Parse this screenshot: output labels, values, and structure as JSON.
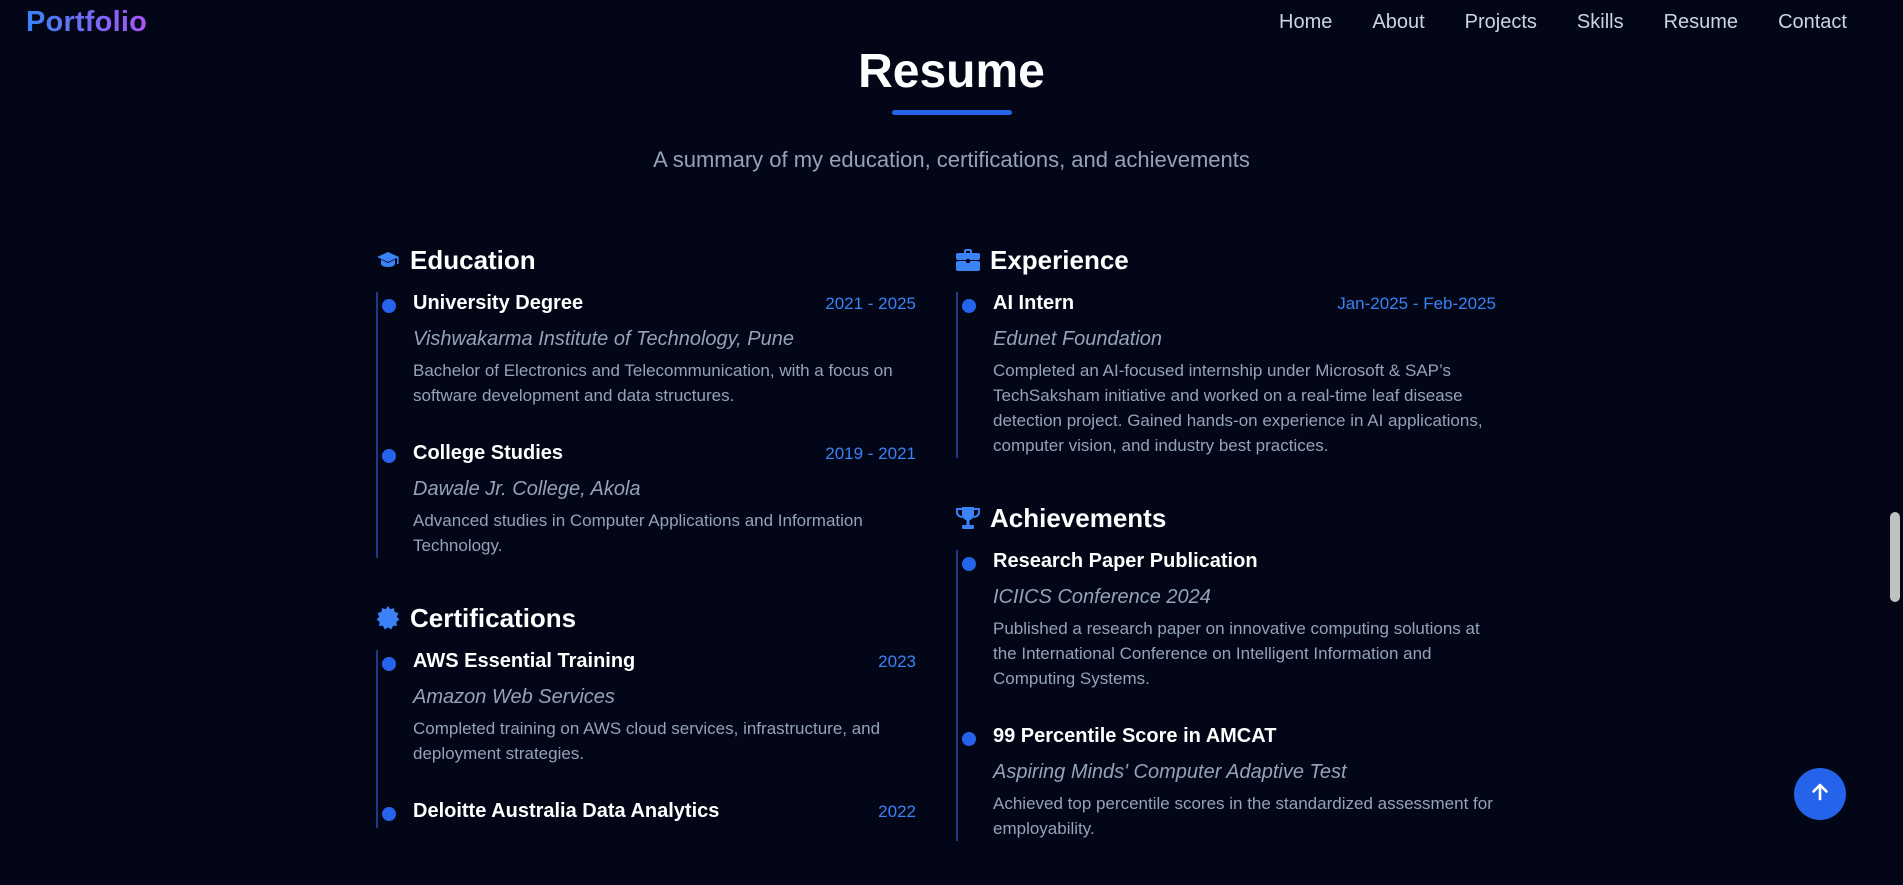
{
  "nav": {
    "logo": "Portfolio",
    "links": [
      "Home",
      "About",
      "Projects",
      "Skills",
      "Resume",
      "Contact"
    ]
  },
  "header": {
    "title": "Resume",
    "subtitle": "A summary of my education, certifications, and achievements"
  },
  "education": {
    "title": "Education",
    "icon": "graduation-cap-icon",
    "entries": [
      {
        "title": "University Degree",
        "date": "2021 - 2025",
        "org": "Vishwakarma Institute of Technology, Pune",
        "desc": "Bachelor of Electronics and Telecommunication, with a focus on software development and data structures."
      },
      {
        "title": "College Studies",
        "date": "2019 - 2021",
        "org": "Dawale Jr. College, Akola",
        "desc": "Advanced studies in Computer Applications and Information Technology."
      }
    ]
  },
  "certifications": {
    "title": "Certifications",
    "icon": "certificate-icon",
    "entries": [
      {
        "title": "AWS Essential Training",
        "date": "2023",
        "org": "Amazon Web Services",
        "desc": "Completed training on AWS cloud services, infrastructure, and deployment strategies."
      },
      {
        "title": "Deloitte Australia Data Analytics",
        "date": "2022"
      }
    ]
  },
  "experience": {
    "title": "Experience",
    "icon": "briefcase-icon",
    "entries": [
      {
        "title": "AI Intern",
        "date": "Jan-2025 - Feb-2025",
        "org": "Edunet Foundation",
        "desc": "Completed an AI-focused internship under Microsoft & SAP’s TechSaksham initiative and worked on a real-time leaf disease detection project. Gained hands-on experience in AI applications, computer vision, and industry best practices."
      }
    ]
  },
  "achievements": {
    "title": "Achievements",
    "icon": "trophy-icon",
    "entries": [
      {
        "title": "Research Paper Publication",
        "org": "ICIICS Conference 2024",
        "desc": "Published a research paper on innovative computing solutions at the International Conference on Intelligent Information and Computing Systems."
      },
      {
        "title": "99 Percentile Score in AMCAT",
        "org": "Aspiring Minds' Computer Adaptive Test",
        "desc": "Achieved top percentile scores in the standardized assessment for employability."
      }
    ]
  },
  "colors": {
    "background": "#020617",
    "accent": "#2563eb",
    "date": "#3b82f6",
    "muted": "#94a3b8"
  },
  "scroll_top_icon": "arrow-up-icon"
}
